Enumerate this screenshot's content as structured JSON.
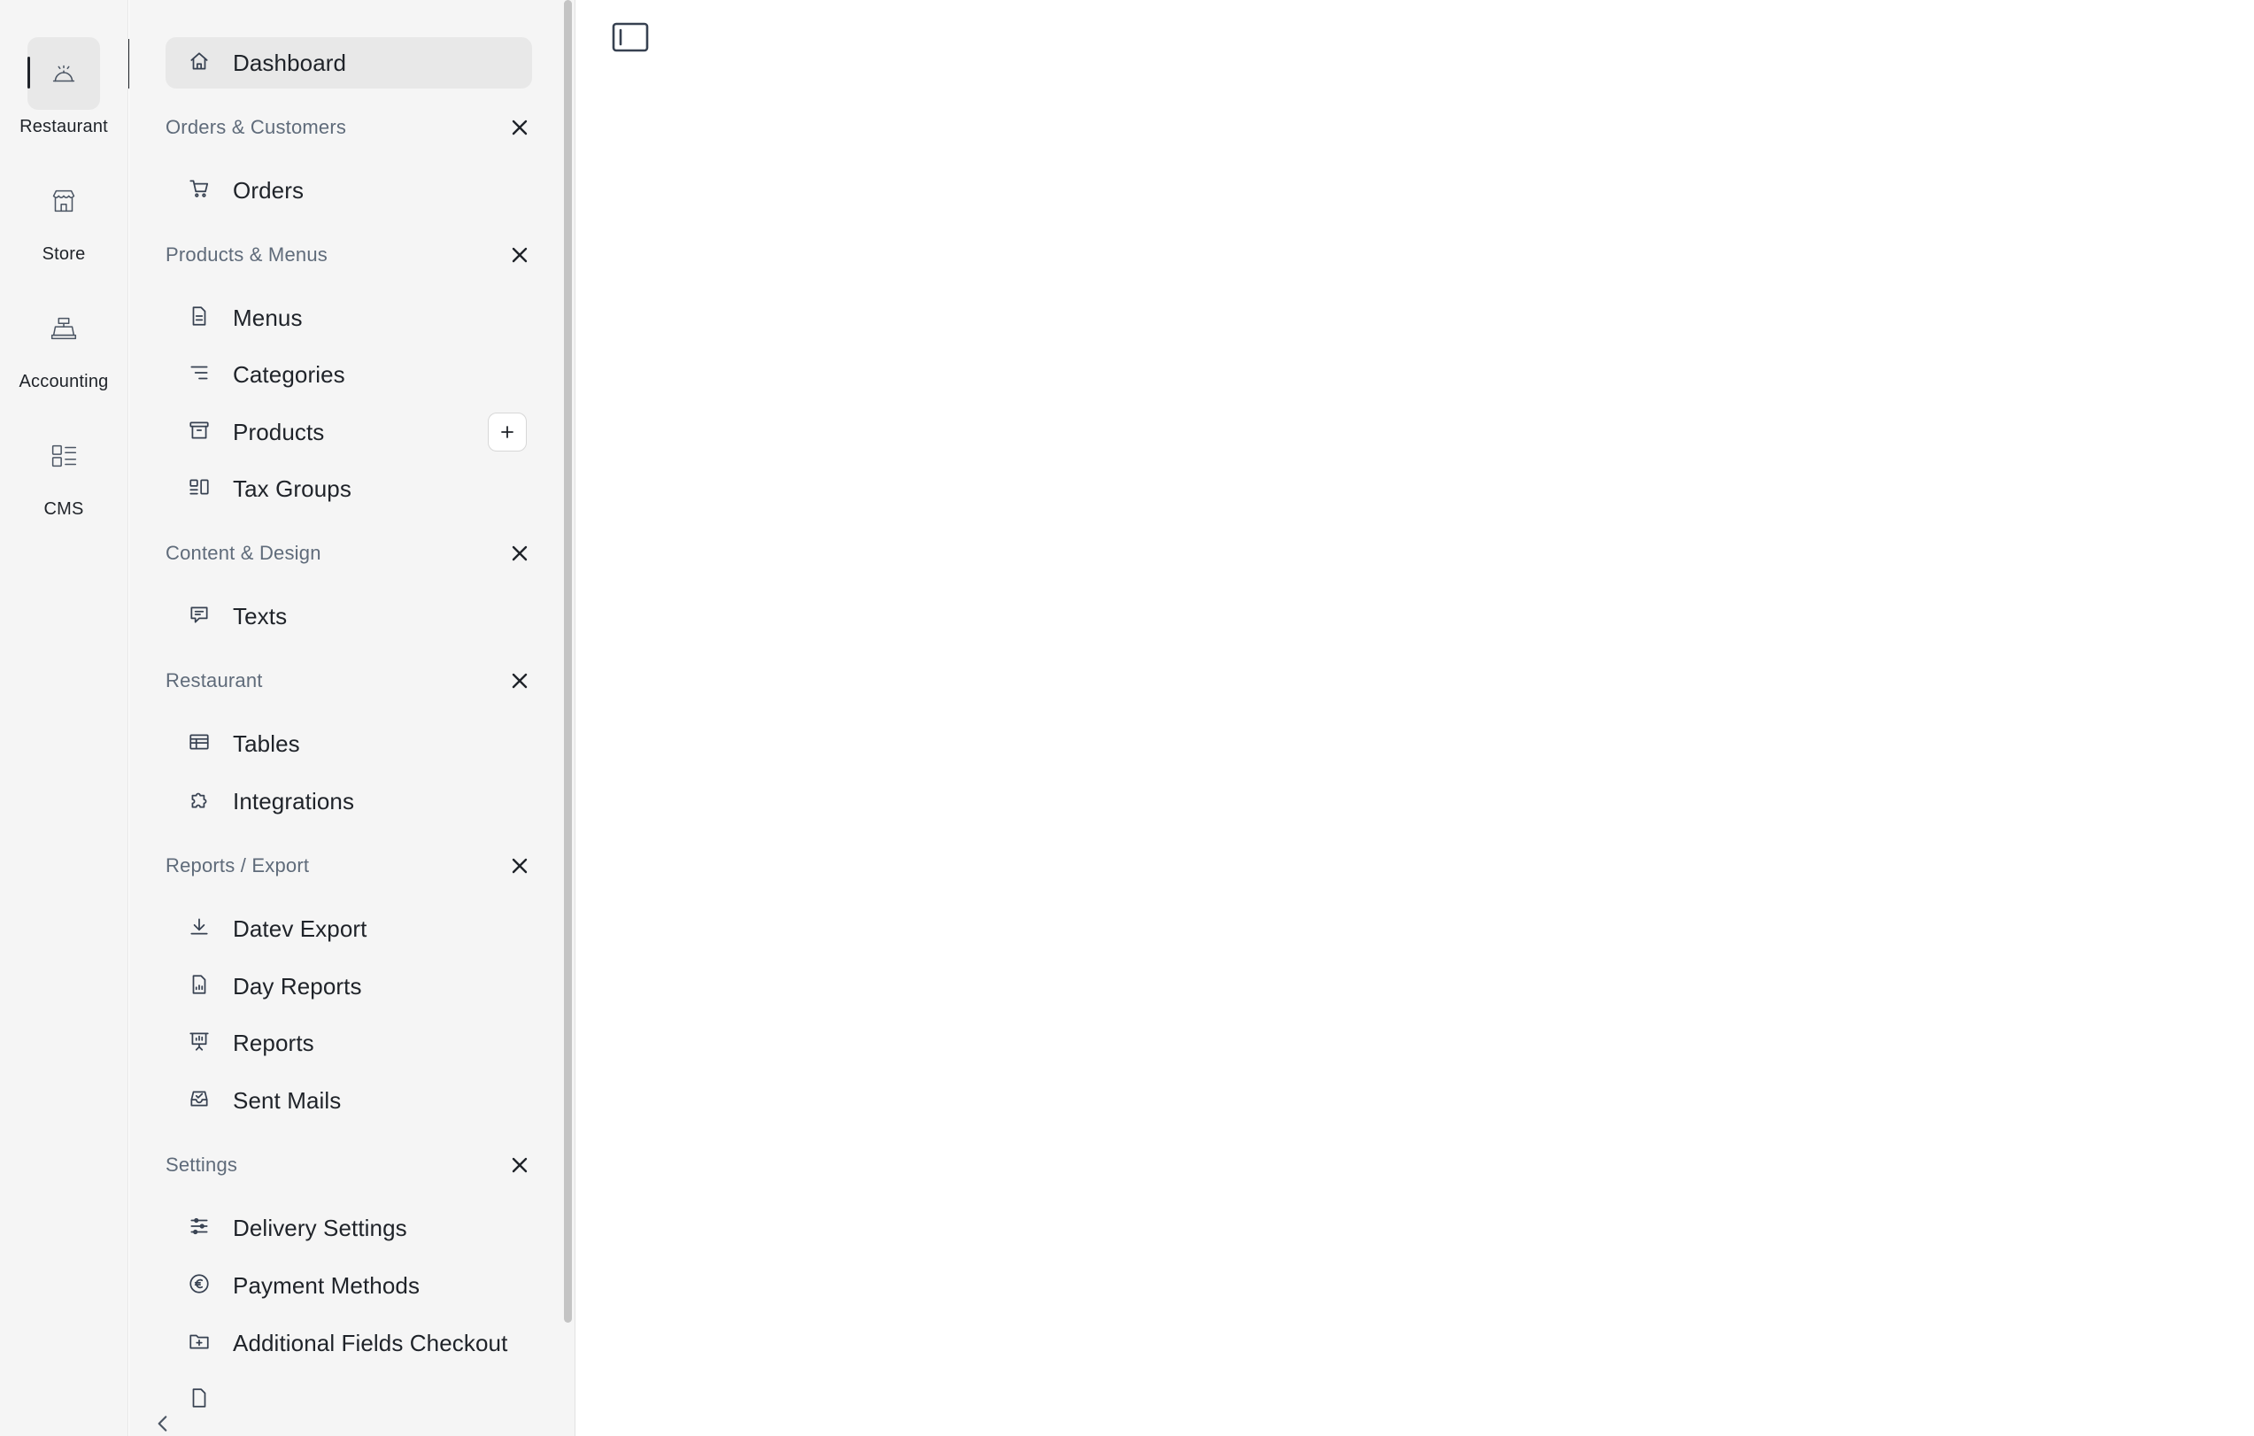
{
  "rail": {
    "items": [
      {
        "label": "Restaurant",
        "icon": "restaurant-bell-icon",
        "active": true
      },
      {
        "label": "Store",
        "icon": "store-icon",
        "active": false
      },
      {
        "label": "Accounting",
        "icon": "cash-register-icon",
        "active": false
      },
      {
        "label": "CMS",
        "icon": "layout-list-icon",
        "active": false
      }
    ]
  },
  "sidebar": {
    "dashboard": {
      "label": "Dashboard",
      "icon": "home-icon"
    },
    "sections": [
      {
        "title": "Orders & Customers",
        "items": [
          {
            "label": "Orders",
            "icon": "cart-icon"
          }
        ]
      },
      {
        "title": "Products & Menus",
        "items": [
          {
            "label": "Menus",
            "icon": "document-icon"
          },
          {
            "label": "Categories",
            "icon": "list-lines-icon"
          },
          {
            "label": "Products",
            "icon": "archive-box-icon",
            "has_add": true
          },
          {
            "label": "Tax Groups",
            "icon": "tax-groups-icon"
          }
        ]
      },
      {
        "title": "Content & Design",
        "items": [
          {
            "label": "Texts",
            "icon": "speech-bubble-icon"
          }
        ]
      },
      {
        "title": "Restaurant",
        "items": [
          {
            "label": "Tables",
            "icon": "table-icon"
          },
          {
            "label": "Integrations",
            "icon": "puzzle-icon"
          }
        ]
      },
      {
        "title": "Reports / Export",
        "items": [
          {
            "label": "Datev Export",
            "icon": "download-icon"
          },
          {
            "label": "Day Reports",
            "icon": "report-document-icon"
          },
          {
            "label": "Reports",
            "icon": "presentation-chart-icon"
          },
          {
            "label": "Sent Mails",
            "icon": "inbox-icon"
          }
        ]
      },
      {
        "title": "Settings",
        "items": [
          {
            "label": "Delivery Settings",
            "icon": "sliders-icon"
          },
          {
            "label": "Payment Methods",
            "icon": "euro-icon"
          },
          {
            "label": "Additional Fields Checkout",
            "icon": "folder-plus-icon"
          }
        ]
      }
    ]
  },
  "main": {
    "toggle_icon": "sidebar-toggle-icon"
  }
}
